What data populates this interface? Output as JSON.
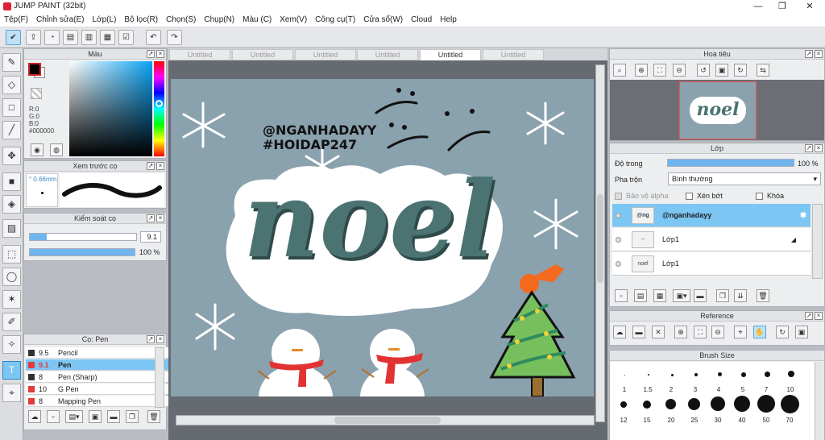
{
  "window": {
    "title": "JUMP PAINT (32bit)",
    "minimize": "—",
    "maximize": "❐",
    "close": "✕"
  },
  "menu": [
    "Tệp(F)",
    "Chỉnh sửa(E)",
    "Lớp(L)",
    "Bộ lọc(R)",
    "Chọn(S)",
    "Chụp(N)",
    "Màu (C)",
    "Xem(V)",
    "Công cụ(T)",
    "Cửa sổ(W)",
    "Cloud",
    "Help"
  ],
  "color_panel": {
    "title": "Màu",
    "r": "R:0",
    "g": "G:0",
    "b": "B:0",
    "hex": "#000000",
    "primary": "#000000",
    "secondary": "#ffffff"
  },
  "preview_panel": {
    "title": "Xem trước cọ",
    "size": "° 0.66mm"
  },
  "brush_control": {
    "title": "Kiểm soát cọ",
    "size_value": "9.1",
    "opacity_value": "100 %",
    "size_fraction": 0.16,
    "opacity_fraction": 1.0
  },
  "brush_panel": {
    "title": "Cọ: Pen",
    "brushes": [
      {
        "size": "9.5",
        "name": "Pencil",
        "color": "#333333"
      },
      {
        "size": "9.1",
        "name": "Pen",
        "color": "#e23b3b",
        "selected": true
      },
      {
        "size": "8",
        "name": "Pen (Sharp)",
        "color": "#333333"
      },
      {
        "size": "10",
        "name": "G Pen",
        "color": "#e23b3b"
      },
      {
        "size": "8",
        "name": "Mapping Pen",
        "color": "#e23b3b"
      }
    ]
  },
  "tabs": [
    "Untitled",
    "Untitled",
    "Untitled",
    "Untitled",
    "Untitled",
    "Untitled"
  ],
  "active_tab": 4,
  "canvas": {
    "handle1": "@NGANHADAYY",
    "handle2": "#HOIDAP247",
    "word": "noel",
    "bg_color": "#8aa1ae"
  },
  "navigator": {
    "title": "Hoa tiêu",
    "thumb_text": "noel"
  },
  "layer_panel": {
    "title": "Lớp",
    "opacity_label": "Độ trong",
    "opacity_value": "100 %",
    "opacity_fraction": 1.0,
    "blend_label": "Pha trộn",
    "blend_value": "Bình thường",
    "protect_alpha": "Bảo vệ alpha",
    "clip": "Xén bớt",
    "lock": "Khóa",
    "layers": [
      {
        "name": "@nganhadayy",
        "thumb": "@ng",
        "selected": true
      },
      {
        "name": "Lớp1",
        "thumb": "~",
        "selected": false
      },
      {
        "name": "Lớp1",
        "thumb": "noel",
        "selected": false
      }
    ]
  },
  "reference_panel": {
    "title": "Reference"
  },
  "brush_size_panel": {
    "title": "Brush Size",
    "row1": [
      "1",
      "1.5",
      "2",
      "3",
      "4",
      "5",
      "7",
      "10"
    ],
    "row2": [
      "12",
      "15",
      "20",
      "25",
      "30",
      "40",
      "50",
      "70"
    ]
  }
}
